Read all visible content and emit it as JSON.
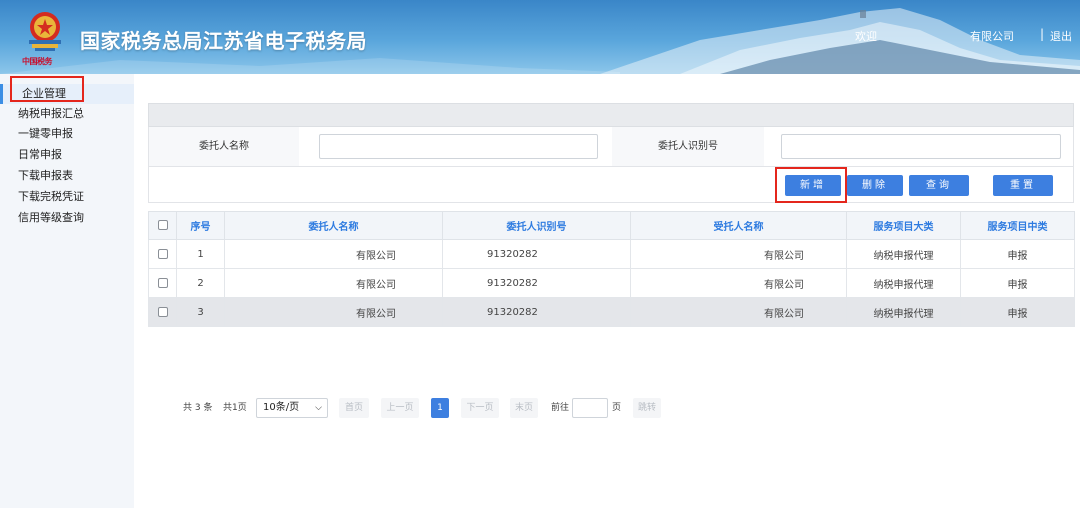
{
  "header": {
    "title": "国家税务总局江苏省电子税务局",
    "brand_script": "中国税务",
    "welcome": "欢迎",
    "company": "有限公司",
    "separator": "|",
    "logout": "退出"
  },
  "sidebar": {
    "items": [
      {
        "label": "企业管理",
        "active": true
      },
      {
        "label": "纳税申报汇总"
      },
      {
        "label": "一键零申报"
      },
      {
        "label": "日常申报"
      },
      {
        "label": "下载申报表"
      },
      {
        "label": "下载完税凭证"
      },
      {
        "label": "信用等级查询"
      }
    ]
  },
  "search": {
    "client_name_label": "委托人名称",
    "client_id_label": "委托人识别号",
    "client_name_value": "",
    "client_id_value": ""
  },
  "buttons": {
    "add": "新增",
    "delete": "删除",
    "query": "查询",
    "reset": "重置"
  },
  "table": {
    "columns": [
      "序号",
      "委托人名称",
      "委托人识别号",
      "受托人名称",
      "服务项目大类",
      "服务项目中类"
    ],
    "rows": [
      {
        "no": "1",
        "client_name": "有限公司",
        "client_id": "91320282",
        "agent_name": "有限公司",
        "category": "纳税申报代理",
        "subcategory": "申报",
        "selected": false
      },
      {
        "no": "2",
        "client_name": "有限公司",
        "client_id": "91320282",
        "agent_name": "有限公司",
        "category": "纳税申报代理",
        "subcategory": "申报",
        "selected": false
      },
      {
        "no": "3",
        "client_name": "有限公司",
        "client_id": "91320282",
        "agent_name": "有限公司",
        "category": "纳税申报代理",
        "subcategory": "申报",
        "selected": true
      }
    ]
  },
  "pagination": {
    "total_items": "共 3 条",
    "total_pages": "共1页",
    "page_size": "10条/页",
    "first": "首页",
    "prev": "上一页",
    "current": "1",
    "next": "下一页",
    "last": "末页",
    "goto_prefix": "前往",
    "goto_suffix": "页",
    "jump": "跳转"
  },
  "colors": {
    "primary": "#3d7fe0",
    "header_blue": "#3a86c8",
    "highlight_red": "#e4261c",
    "th_text": "#2e7be0"
  },
  "icons": [
    "national-tax-emblem-icon",
    "checkbox-icon",
    "chevron-down-icon"
  ]
}
